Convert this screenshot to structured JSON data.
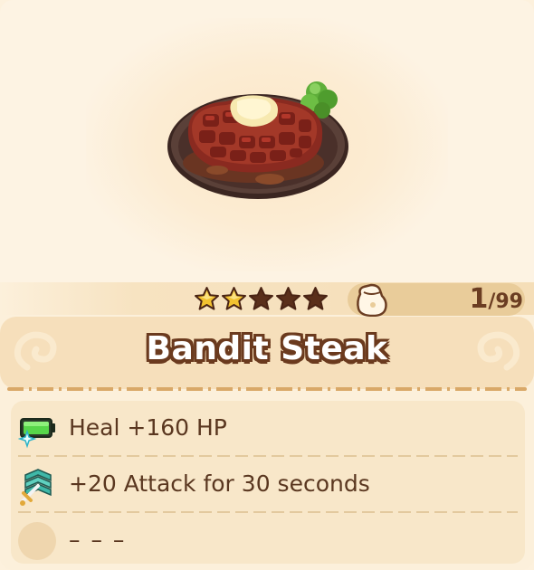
{
  "item": {
    "name": "Bandit Steak",
    "image_icon": "steak-with-butter-icon",
    "rarity": {
      "filled": 2,
      "total": 5,
      "filled_color": "#f2c230",
      "empty_color": "#5a2f1a"
    },
    "count": {
      "current": "1",
      "max": "/99"
    },
    "bag_icon": "item-bag-icon"
  },
  "effects": [
    {
      "icon": "battery-heal-icon",
      "label": "Heal +160 HP"
    },
    {
      "icon": "attack-sword-chevron-icon",
      "label": "+20 Attack for 30 seconds"
    },
    {
      "icon": "empty-slot-icon",
      "label": "– – –"
    }
  ],
  "colors": {
    "background": "#fcf0db",
    "title_outline": "#6b3a1e",
    "text": "#5a3720",
    "accent_tan": "#e9cc9a"
  }
}
